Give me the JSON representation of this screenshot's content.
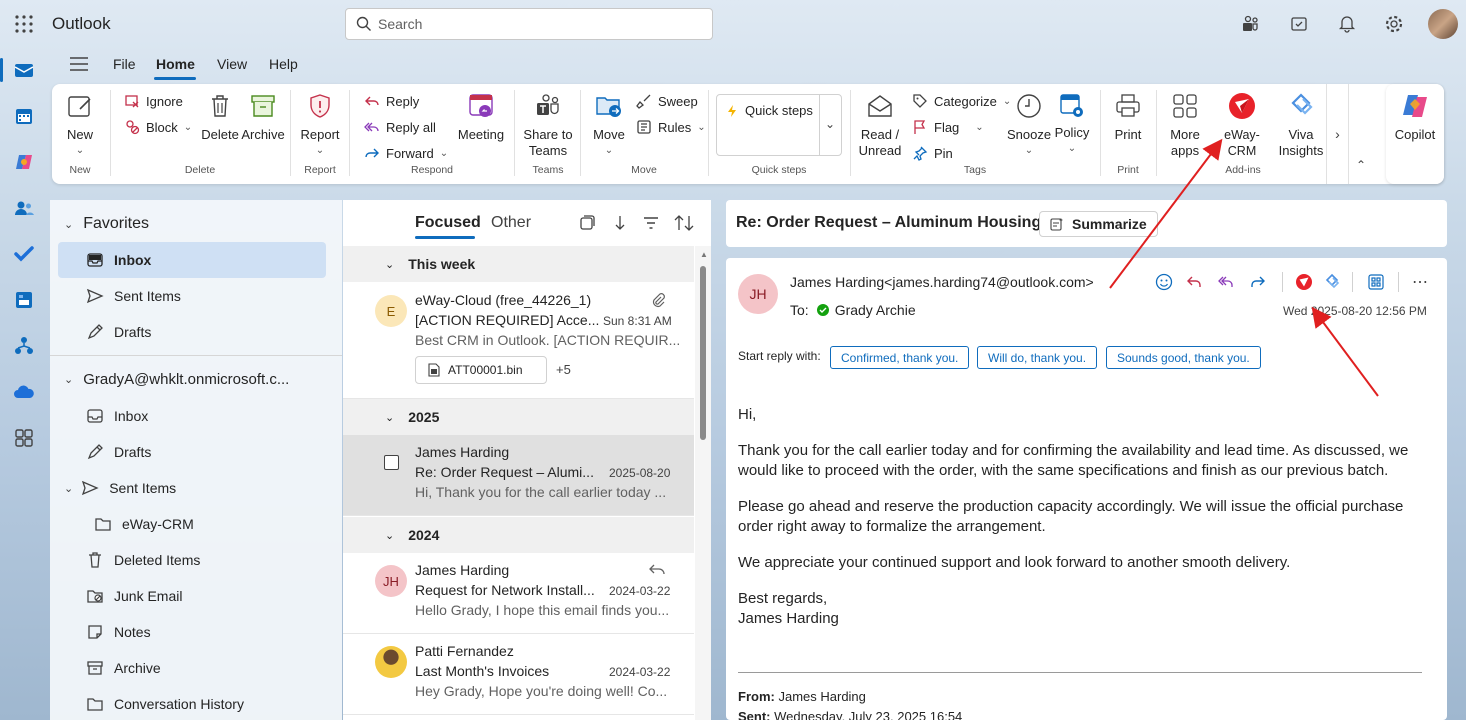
{
  "app": {
    "title": "Outlook"
  },
  "search": {
    "placeholder": "Search"
  },
  "ribbon_tabs": [
    "File",
    "Home",
    "View",
    "Help"
  ],
  "ribbon": {
    "new": {
      "label": "New",
      "group": "New"
    },
    "delete_group": {
      "ignore": "Ignore",
      "block": "Block",
      "delete": "Delete",
      "archive": "Archive",
      "group": "Delete"
    },
    "report": {
      "label": "Report",
      "group": "Report"
    },
    "respond": {
      "reply": "Reply",
      "reply_all": "Reply all",
      "forward": "Forward",
      "meeting": "Meeting",
      "group": "Respond"
    },
    "teams": {
      "label1": "Share to",
      "label2": "Teams",
      "group": "Teams"
    },
    "move": {
      "move": "Move",
      "sweep": "Sweep",
      "rules": "Rules",
      "group": "Move"
    },
    "quick_steps": {
      "label": "Quick steps",
      "group": "Quick steps"
    },
    "tags": {
      "read1": "Read /",
      "read2": "Unread",
      "categorize": "Categorize",
      "flag": "Flag",
      "pin": "Pin",
      "snooze": "Snooze",
      "policy": "Policy",
      "group": "Tags"
    },
    "print": {
      "label": "Print",
      "group": "Print"
    },
    "addins": {
      "more1": "More",
      "more2": "apps",
      "eway": "eWay-CRM",
      "viva1": "Viva",
      "viva2": "Insights",
      "group": "Add-ins"
    },
    "copilot": "Copilot"
  },
  "folders": {
    "favorites_label": "Favorites",
    "favorites": [
      "Inbox",
      "Sent Items",
      "Drafts"
    ],
    "account": "GradyA@whklt.onmicrosoft.c...",
    "account_items": [
      "Inbox",
      "Drafts",
      "Sent Items",
      "eWay-CRM",
      "Deleted Items",
      "Junk Email",
      "Notes",
      "Archive",
      "Conversation History"
    ]
  },
  "list": {
    "tab_focused": "Focused",
    "tab_other": "Other",
    "section_week": "This week",
    "section_2025": "2025",
    "section_2024": "2024",
    "messages": [
      {
        "avatar": "E",
        "sender": "eWay-Cloud (free_44226_1)",
        "subject": "[ACTION REQUIRED] Acce...",
        "date": "Sun 8:31 AM",
        "preview": "Best CRM in Outlook. [ACTION REQUIR...",
        "attachment": "ATT00001.bin",
        "more": "+5"
      },
      {
        "sender": "James Harding",
        "subject": "Re: Order Request – Alumi...",
        "date": "2025-08-20",
        "preview": "Hi, Thank you for the call earlier today ..."
      },
      {
        "avatar": "JH",
        "sender": "James Harding",
        "subject": "Request for Network Install...",
        "date": "2024-03-22",
        "preview": "Hello Grady, I hope this email finds you..."
      },
      {
        "sender": "Patti Fernandez",
        "subject": "Last Month's Invoices",
        "date": "2024-03-22",
        "preview": "Hey Grady, Hope you're doing well! Co..."
      }
    ]
  },
  "reading": {
    "subject": "Re: Order Request – Aluminum Housings",
    "summarize": "Summarize",
    "avatar": "JH",
    "from": "James Harding<james.harding74@outlook.com>",
    "to_label": "To:",
    "to": "Grady Archie",
    "date": "Wed 2025-08-20 12:56 PM",
    "start_reply": "Start reply with:",
    "quick_replies": [
      "Confirmed, thank you.",
      "Will do, thank you.",
      "Sounds good, thank you."
    ],
    "body": [
      "Hi,",
      "Thank you for the call earlier today and for confirming the availability and lead time. As discussed, we would like to proceed with the order, with the same specifications and finish as our previous batch.",
      "Please go ahead and reserve the production capacity accordingly. We will issue the official purchase order right away to formalize the arrangement.",
      "We appreciate your continued support and look forward to another smooth delivery.",
      "Best regards,",
      "James Harding"
    ],
    "quoted_from_label": "From:",
    "quoted_from": "James Harding",
    "quoted_sent_label": "Sent:",
    "quoted_sent": "Wednesday, July 23, 2025 16:54"
  },
  "colors": {
    "accent": "#0f6cbd",
    "eway_red": "#e8222a",
    "arrow": "#e02020"
  }
}
